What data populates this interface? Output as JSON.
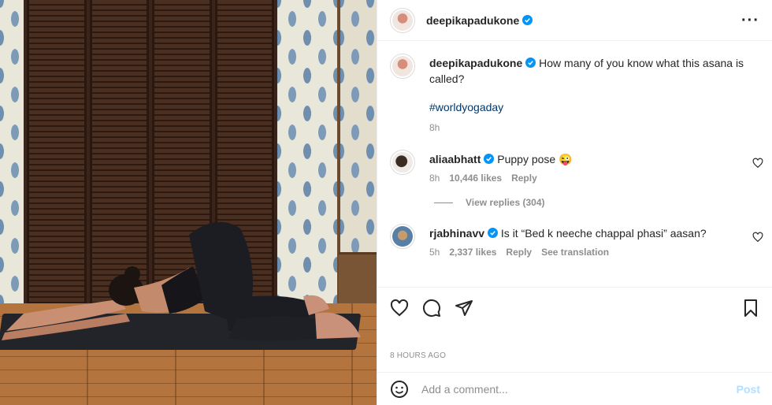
{
  "post": {
    "username": "deepikapadukone",
    "caption": "How many of you know what this asana is called?",
    "hashtag": "#worldyogaday",
    "caption_time": "8h",
    "time_ago": "8 HOURS AGO",
    "image_alt": "Woman doing puppy pose on a yoga mat in front of wooden shutters"
  },
  "comments": [
    {
      "username": "aliaabhatt",
      "text": "Puppy pose 😜",
      "time": "8h",
      "likes": "10,446 likes",
      "reply": "Reply",
      "view_replies": "View replies (304)"
    },
    {
      "username": "rjabhinavv",
      "text": "Is it “Bed k neeche chappal phasi” aasan?",
      "time": "5h",
      "likes": "2,337 likes",
      "reply": "Reply",
      "translation": "See translation"
    }
  ],
  "add_comment": {
    "placeholder": "Add a comment...",
    "post_label": "Post"
  },
  "icons": {
    "verified": "verified-badge-icon",
    "more": "more-options-icon",
    "like": "heart-icon",
    "comment": "comment-icon",
    "share": "share-icon",
    "save": "bookmark-icon",
    "emoji": "emoji-icon"
  },
  "colors": {
    "verified": "#0095f6",
    "link": "#00376b",
    "muted": "#8e8e8e",
    "post_disabled": "#b2dffc"
  }
}
